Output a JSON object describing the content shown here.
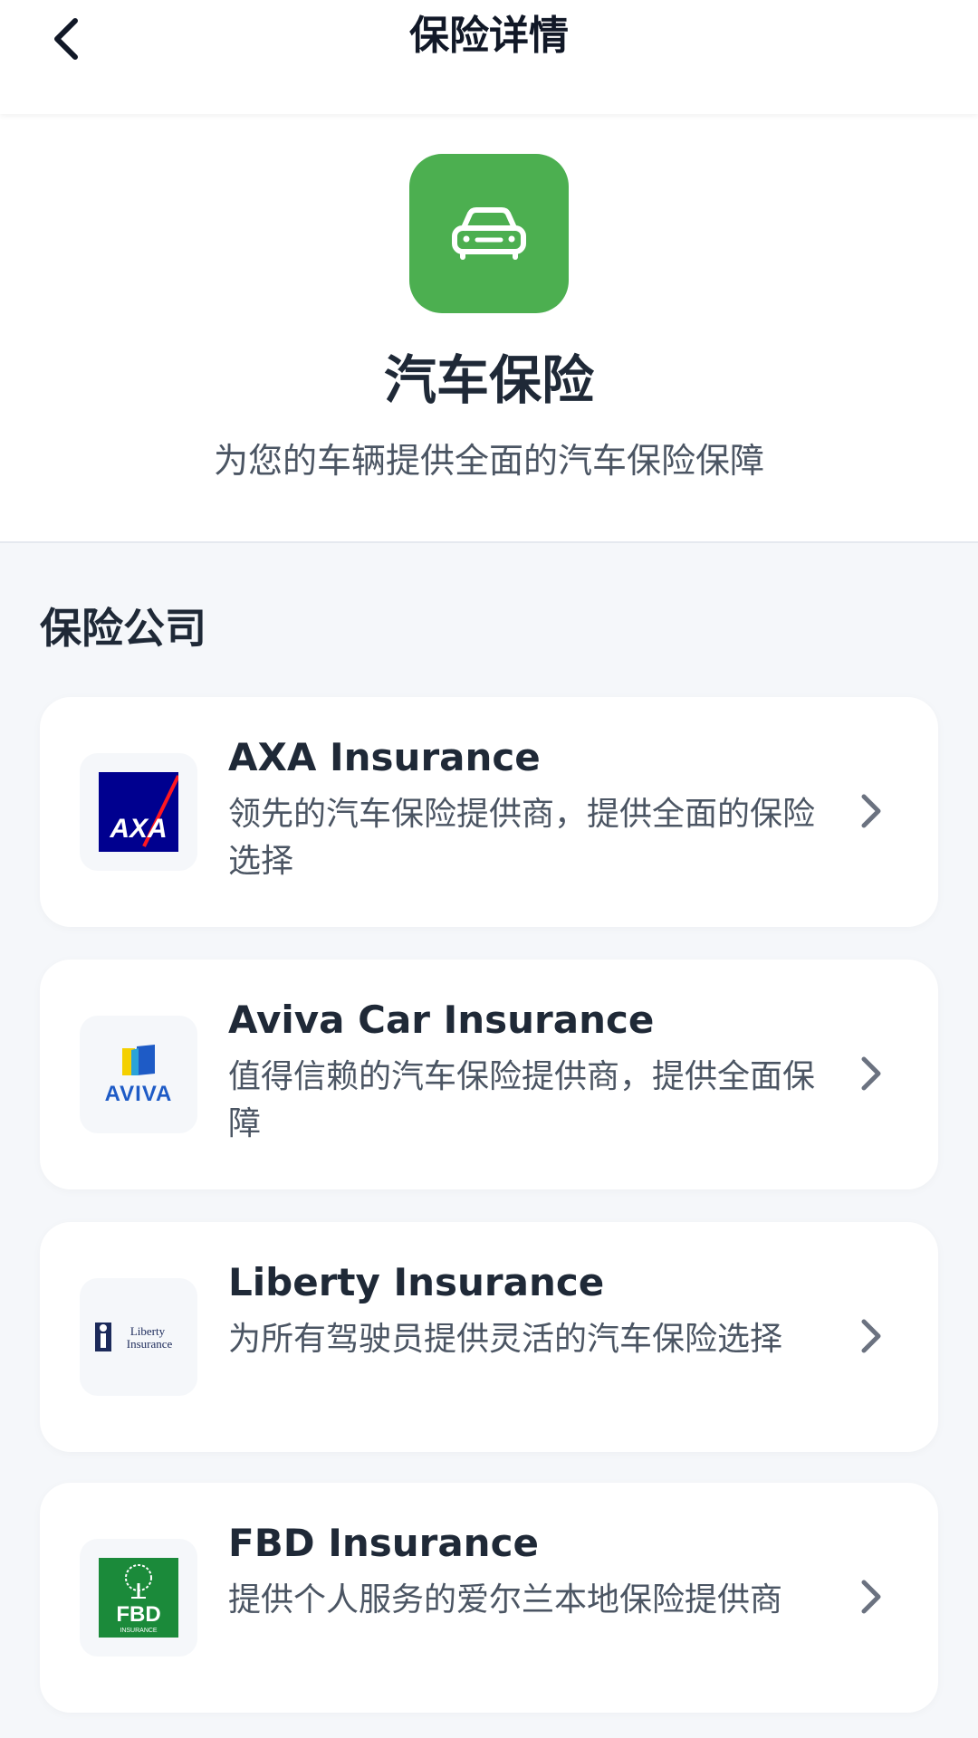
{
  "header": {
    "title": "保险详情",
    "back_icon": "chevron-left-icon"
  },
  "hero": {
    "icon": "car-icon",
    "icon_bg_color": "#4caf50",
    "title": "汽车保险",
    "subtitle": "为您的车辆提供全面的汽车保险保障"
  },
  "section": {
    "title": "保险公司"
  },
  "companies": [
    {
      "name": "AXA Insurance",
      "description": "领先的汽车保险提供商，提供全面的保险选择",
      "logo": "axa-logo",
      "logo_text": "AXA"
    },
    {
      "name": "Aviva Car Insurance",
      "description": "值得信赖的汽车保险提供商，提供全面保障",
      "logo": "aviva-logo",
      "logo_text": "AVIVA"
    },
    {
      "name": "Liberty Insurance",
      "description": "为所有驾驶员提供灵活的汽车保险选择",
      "logo": "liberty-logo",
      "logo_text": "Liberty Insurance"
    },
    {
      "name": "FBD Insurance",
      "description": "提供个人服务的爱尔兰本地保险提供商",
      "logo": "fbd-logo",
      "logo_text": "FBD"
    }
  ],
  "colors": {
    "accent_green": "#4caf50",
    "axa_blue": "#00008f",
    "axa_red": "#ff1721",
    "aviva_blue": "#1e5bc6",
    "fbd_green": "#1b8a3a"
  }
}
